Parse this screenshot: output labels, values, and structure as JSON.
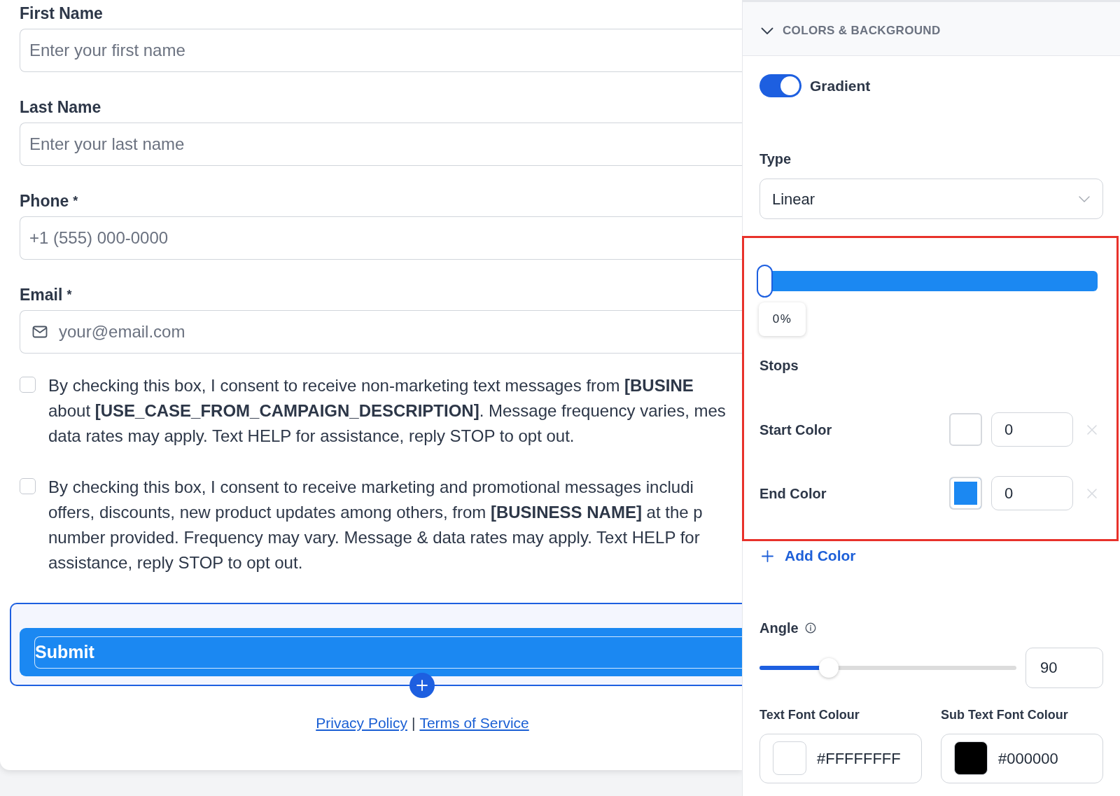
{
  "form": {
    "fields": [
      {
        "kind": "text",
        "label": "First Name",
        "placeholder": "Enter your first name"
      },
      {
        "kind": "text",
        "label": "Last Name",
        "placeholder": "Enter your last name"
      },
      {
        "kind": "tel",
        "label": "Phone",
        "required_mark": "*",
        "placeholder": "+1 (555) 000-0000"
      },
      {
        "kind": "email",
        "label": "Email",
        "required_mark": "*",
        "placeholder": "your@email.com"
      }
    ],
    "consents": [
      {
        "checked": false,
        "lines": [
          "By checking this box, I consent to receive non-marketing text messages from **[BUSINE**",
          "about **[USE_CASE_FROM_CAMPAIGN_DESCRIPTION]**. Message frequency varies, mes",
          "data rates may apply. Text HELP for assistance, reply STOP to opt out."
        ]
      },
      {
        "checked": false,
        "lines": [
          "By checking this box, I consent to receive marketing and promotional messages includi",
          "offers, discounts, new product updates among others, from **[BUSINESS NAME]** at the p",
          "number provided. Frequency may vary. Message & data rates may apply. Text HELP for",
          "assistance, reply STOP to opt out."
        ]
      }
    ],
    "submit": {
      "label": "Submit"
    },
    "footer": {
      "links": [
        "Privacy Policy",
        "Terms of Service"
      ],
      "separator": "|"
    }
  },
  "panel": {
    "section": {
      "title": "COLORS & BACKGROUND",
      "expanded": true
    },
    "gradient_toggle": {
      "label": "Gradient",
      "on": true
    },
    "type_select": {
      "label": "Type",
      "value": "Linear"
    },
    "stops_editor": {
      "highlighted": true,
      "stop_slider": {
        "level": 0,
        "reading": "0%"
      },
      "label": "Stops",
      "stops": [
        {
          "label": "Start Color",
          "color": "#ffffff",
          "value": "0",
          "remove_disabled": true
        },
        {
          "label": "End Color",
          "color": "#1b88f2",
          "value": "0",
          "remove_disabled": true
        }
      ],
      "add_button": "Add Color"
    },
    "angle": {
      "label": "Angle",
      "level": 0.27,
      "value": "90"
    },
    "font_colours": [
      {
        "label": "Text Font Colour",
        "color": "#ffffff",
        "value": "#FFFFFFFF"
      },
      {
        "label": "Sub Text Font Colour",
        "color": "#000000",
        "value": "#000000"
      }
    ]
  }
}
